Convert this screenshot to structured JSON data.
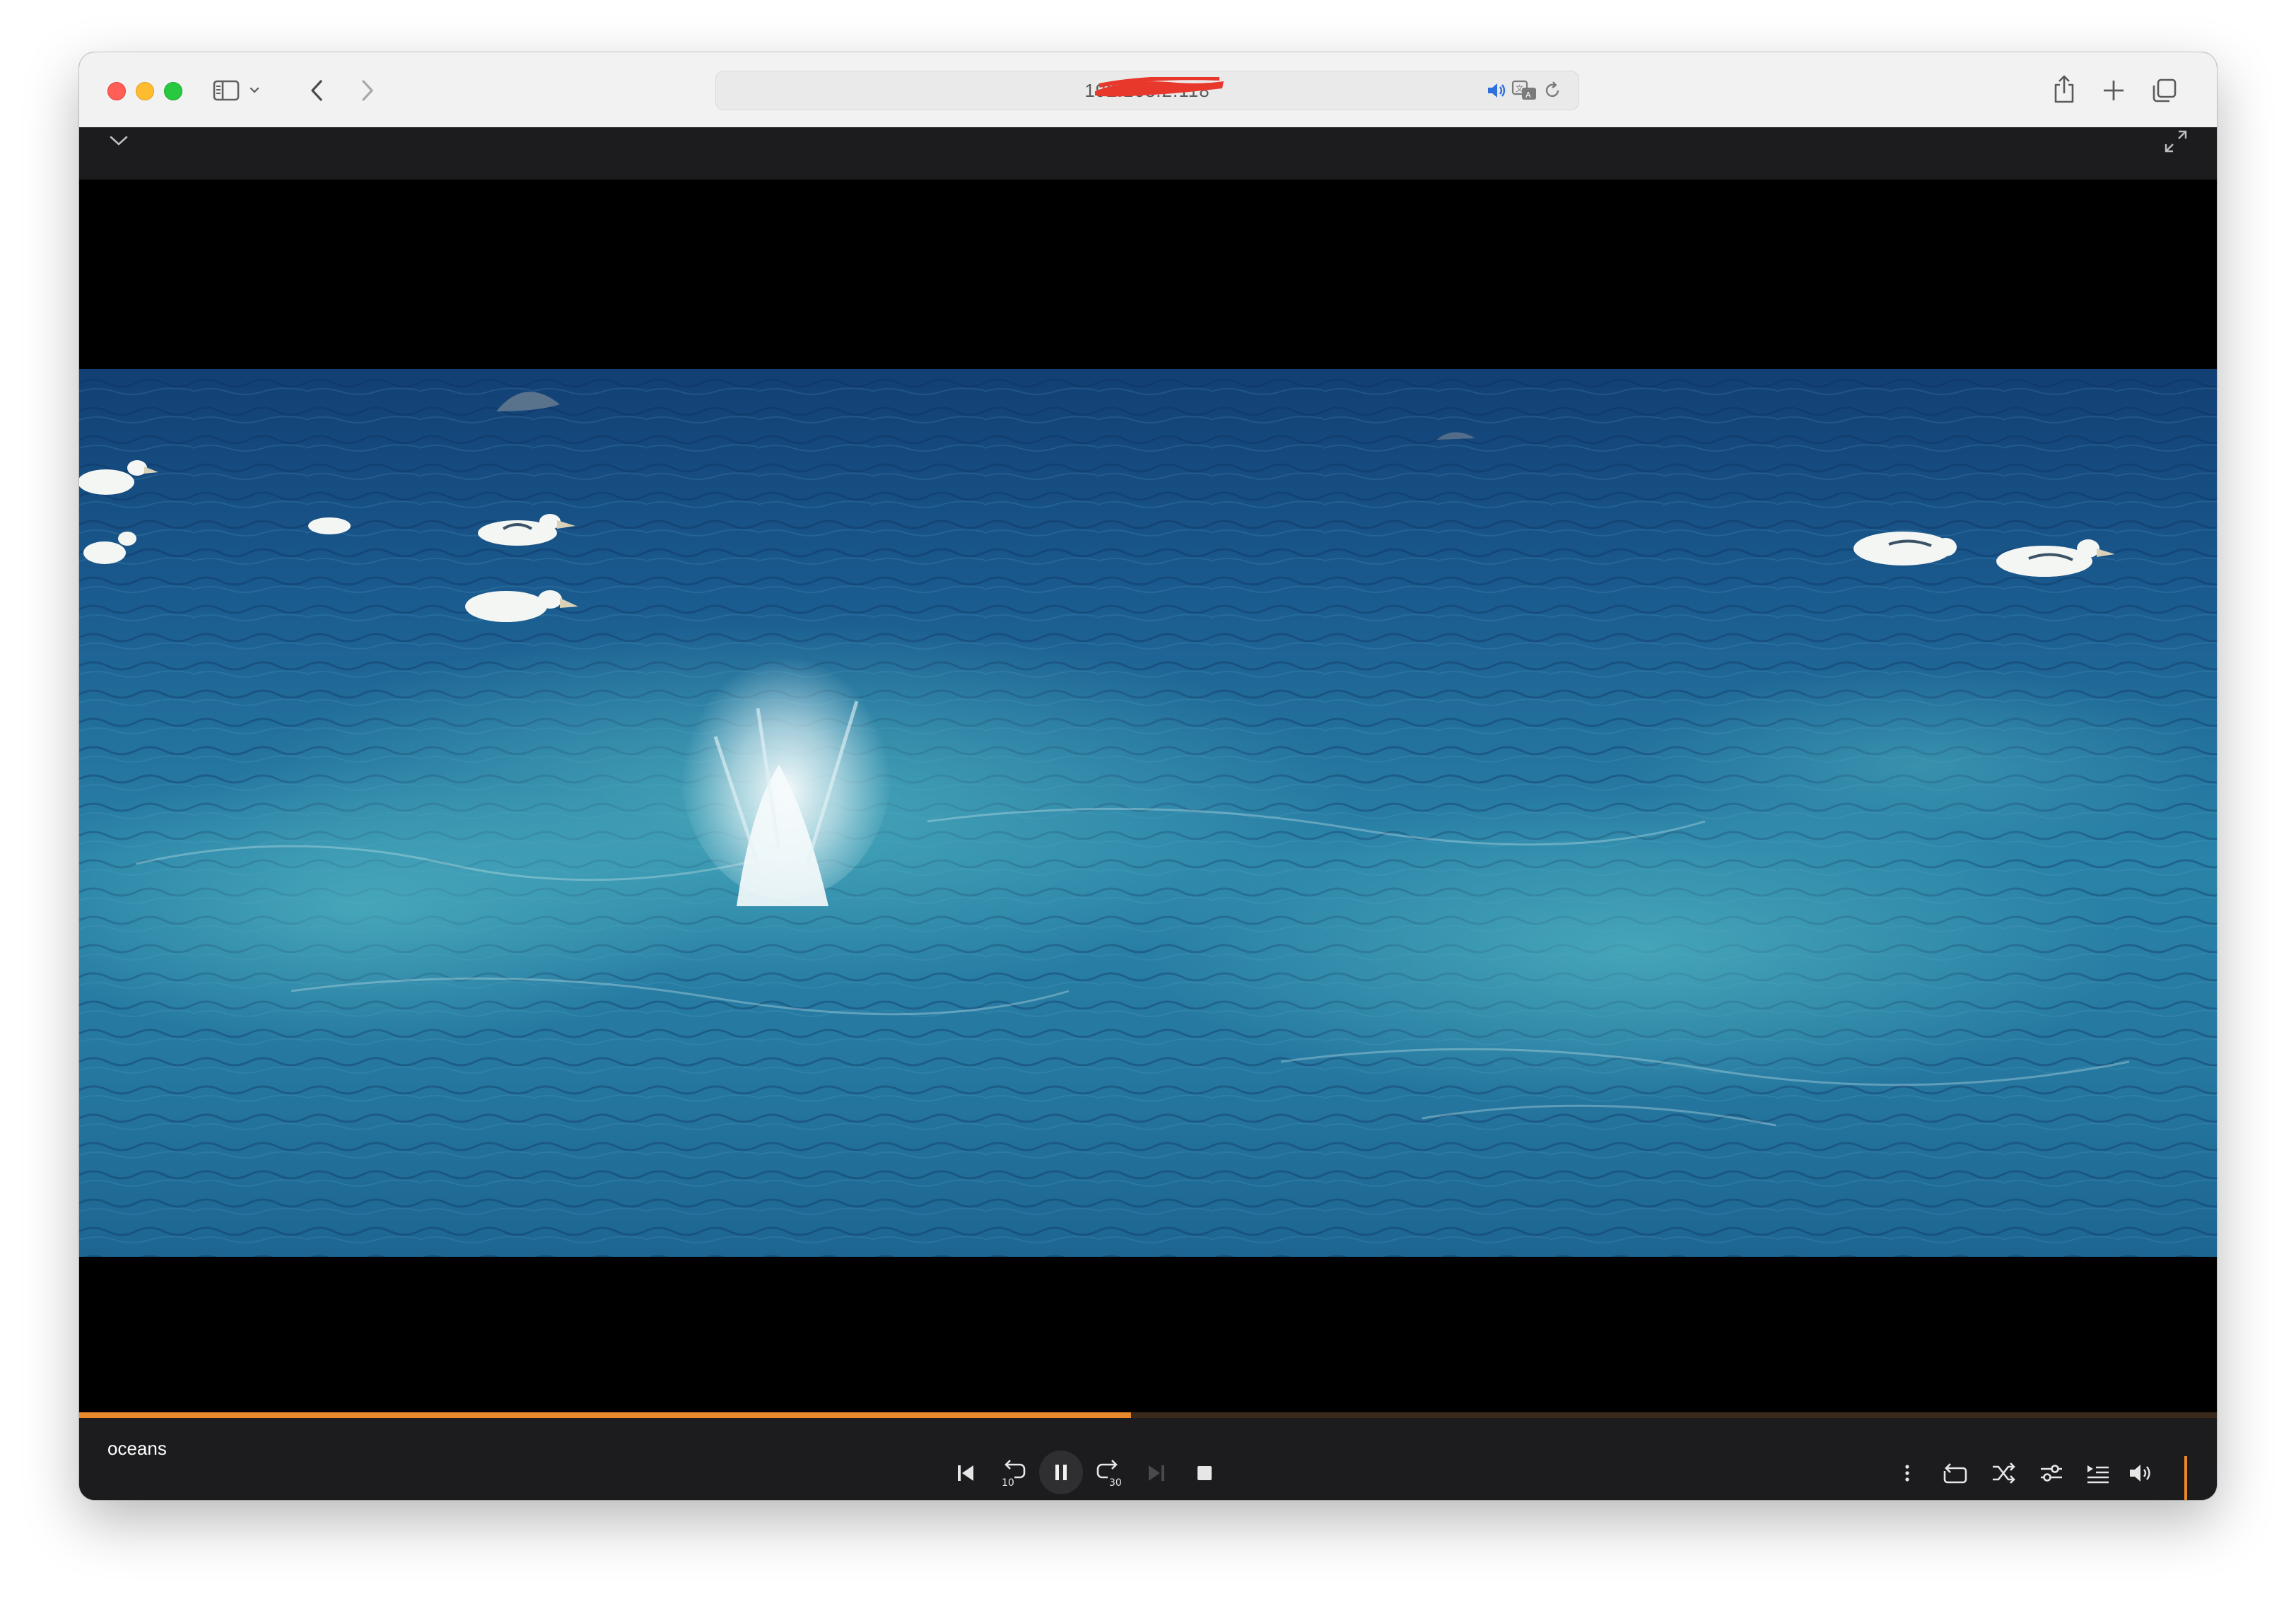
{
  "browser": {
    "address_text": "192.168.2.118",
    "icons": [
      "sidebar-icon",
      "chevron-down-icon",
      "back-arrow-icon",
      "forward-arrow-icon",
      "speaker-icon",
      "translate-icon",
      "reload-icon",
      "share-icon",
      "new-tab-icon",
      "tabs-overview-icon"
    ],
    "traffic_lights": {
      "close": "#ff5f57",
      "minimize": "#febc2e",
      "maximize": "#28c840"
    }
  },
  "player": {
    "title": "oceans",
    "progress_fraction": 0.492,
    "accent_color": "#e8892c",
    "volume_fraction": 1.0,
    "controls_left": [
      "collapse-chevron-icon"
    ],
    "controls_right_top": [
      "fullscreen-expand-icon"
    ],
    "transport": [
      "skip-previous-icon",
      "rewind-10-icon",
      "pause-icon",
      "forward-30-icon",
      "skip-next-icon",
      "stop-icon"
    ],
    "rewind_label": "10",
    "forward_label": "30",
    "options": [
      "more-options-icon",
      "repeat-icon",
      "shuffle-icon",
      "equalizer-icon",
      "playlist-icon",
      "volume-icon"
    ]
  }
}
